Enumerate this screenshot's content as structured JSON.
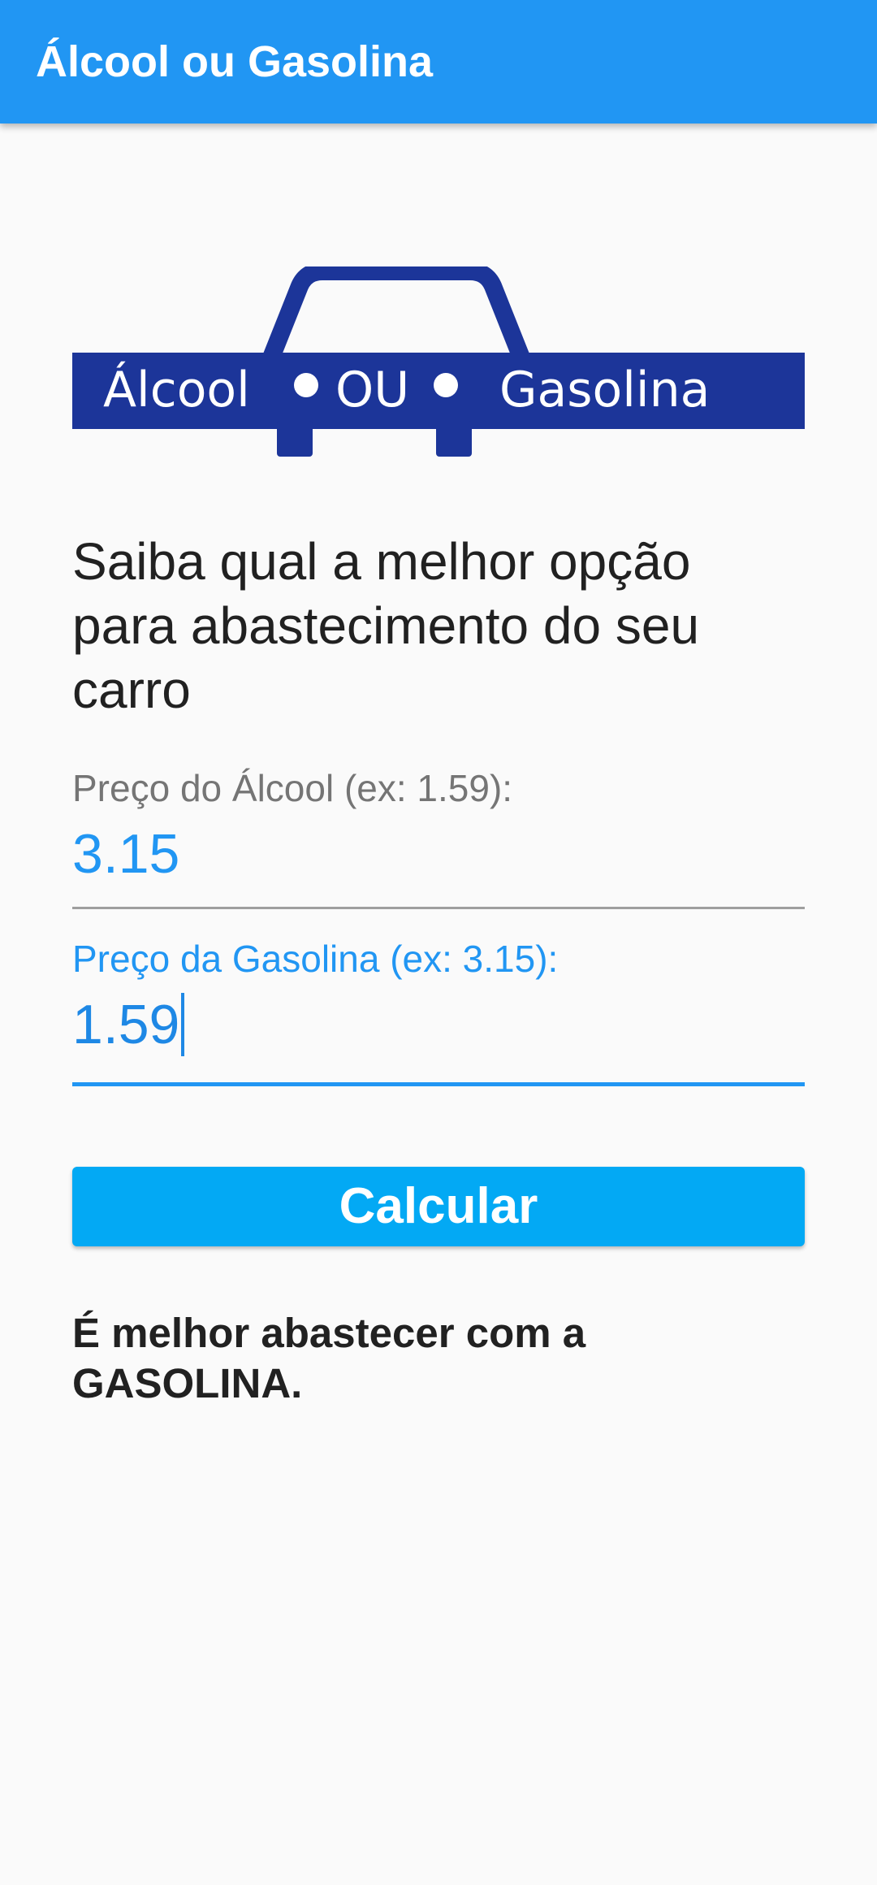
{
  "appbar": {
    "title": "Álcool ou Gasolina",
    "color": "#2196f3"
  },
  "logo": {
    "icon": "car-icon",
    "word_left": "Álcool",
    "word_middle": "OU",
    "word_right": "Gasolina",
    "color": "#1c3599"
  },
  "headline": "Saiba qual a melhor opção para abastecimento do seu carro",
  "form": {
    "alcool": {
      "label": "Preço do Álcool (ex: 1.59):",
      "value": "3.15"
    },
    "gasolina": {
      "label": "Preço da Gasolina (ex: 3.15):",
      "value": "1.59",
      "focused": true
    }
  },
  "button": {
    "label": "Calcular",
    "color": "#03a9f4"
  },
  "result": "É melhor abastecer com a GASOLINA."
}
